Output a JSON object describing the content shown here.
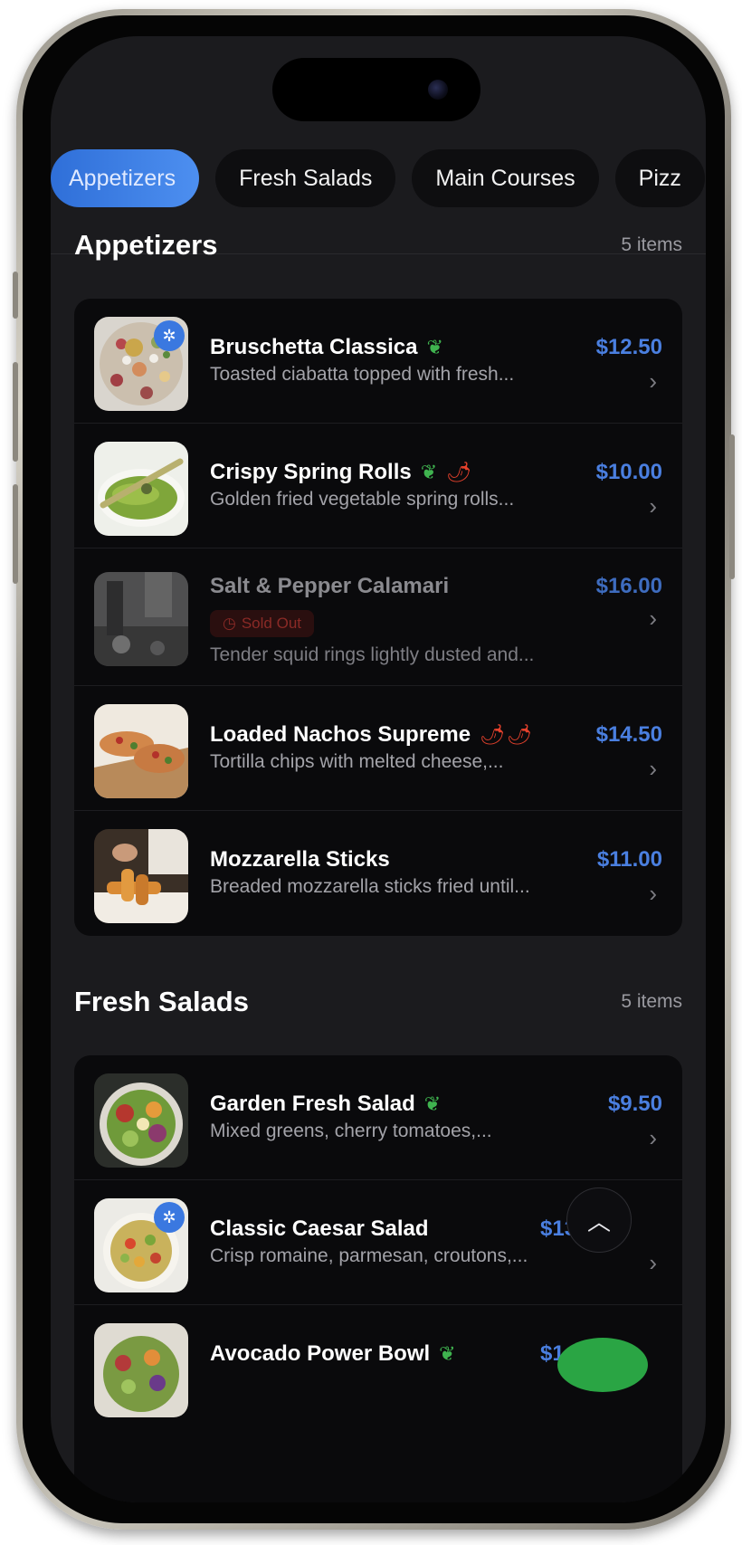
{
  "tabs": [
    {
      "label": "Appetizers",
      "active": true
    },
    {
      "label": "Fresh Salads",
      "active": false
    },
    {
      "label": "Main Courses",
      "active": false
    },
    {
      "label": "Pizz",
      "active": false
    }
  ],
  "sections": [
    {
      "title": "Appetizers",
      "count": "5 items",
      "items": [
        {
          "name": "Bruschetta Classica",
          "desc": "Toasted ciabatta topped with fresh...",
          "price": "$12.50",
          "veg": true,
          "spicy": 0,
          "featured": true
        },
        {
          "name": "Crispy Spring Rolls",
          "desc": "Golden fried vegetable spring rolls...",
          "price": "$10.00",
          "veg": true,
          "spicy": 1
        },
        {
          "name": "Salt & Pepper Calamari",
          "desc": "Tender squid rings lightly dusted and...",
          "price": "$16.00",
          "sold_out": "Sold Out"
        },
        {
          "name": "Loaded Nachos Supreme",
          "desc": "Tortilla chips with melted cheese,...",
          "price": "$14.50",
          "spicy": 2
        },
        {
          "name": "Mozzarella Sticks",
          "desc": "Breaded mozzarella sticks fried until...",
          "price": "$11.00"
        }
      ]
    },
    {
      "title": "Fresh Salads",
      "count": "5 items",
      "items": [
        {
          "name": "Garden Fresh Salad",
          "desc": "Mixed greens, cherry tomatoes,...",
          "price": "$9.50",
          "veg": true
        },
        {
          "name": "Classic Caesar Salad",
          "desc": "Crisp romaine, parmesan, croutons,...",
          "price": "$13",
          "featured": true
        },
        {
          "name": "Avocado Power Bowl",
          "desc": "",
          "price": "$1",
          "veg": true
        }
      ]
    }
  ],
  "icons": {
    "chevron": "›",
    "scroll_top": "︿",
    "featured": "✲",
    "leaf": "❦",
    "chili": "🌶",
    "clock": "◷"
  },
  "colors": {
    "accent": "#4a7fe0",
    "background": "#1b1b1e",
    "card": "#0a0a0c",
    "veg": "#3fb34f",
    "spicy": "#e4412c"
  }
}
